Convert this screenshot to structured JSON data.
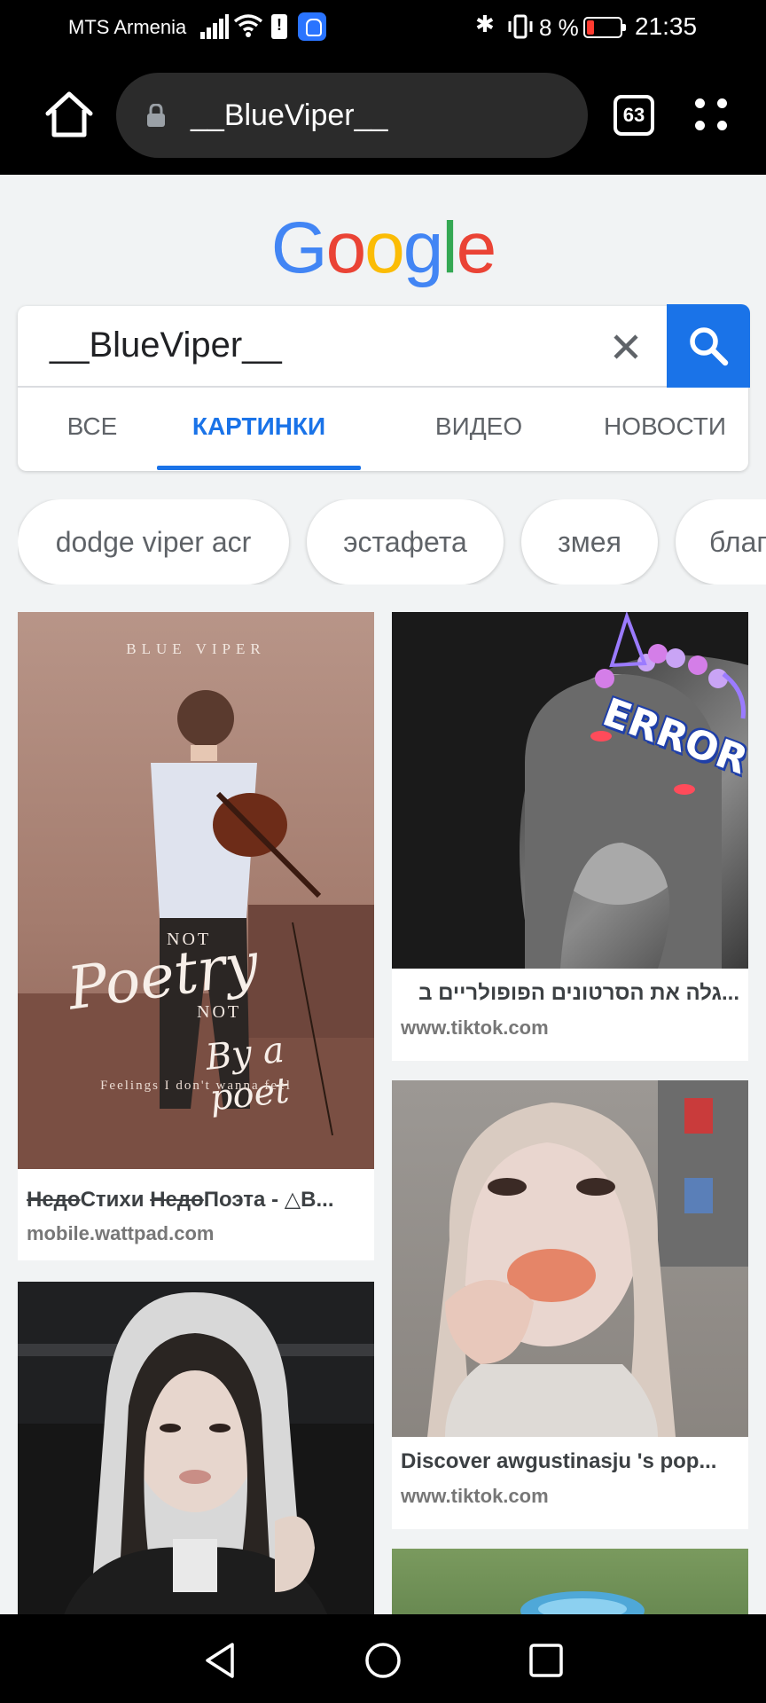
{
  "status_bar": {
    "carrier": "MTS Armenia",
    "battery_percent": "8 %",
    "time": "21:35",
    "battery_level": 0.08
  },
  "browser": {
    "url_text": "__BlueViper__",
    "tab_count": "63",
    "icons": [
      "home-icon",
      "lock-icon",
      "tabs-icon",
      "menu-icon"
    ]
  },
  "logo": {
    "letters": [
      "G",
      "o",
      "o",
      "g",
      "l",
      "e"
    ],
    "colors": [
      "#4285F4",
      "#EA4335",
      "#FBBC05",
      "#4285F4",
      "#34A853",
      "#EA4335"
    ]
  },
  "search": {
    "query": "__BlueViper__",
    "accent": "#1a73e8"
  },
  "tabs": [
    {
      "label": "ВСЕ",
      "active": false
    },
    {
      "label": "КАРТИНКИ",
      "active": true
    },
    {
      "label": "ВИДЕО",
      "active": false
    },
    {
      "label": "НОВОСТИ",
      "active": false
    }
  ],
  "chips": [
    "dodge viper acr",
    "эстафета",
    "змея",
    "благ"
  ],
  "results": [
    {
      "caption_strike_1": "Недо",
      "caption_1": "Стихи ",
      "caption_strike_2": "Недо",
      "caption_2": "Поэта - △B...",
      "source": "mobile.wattpad.com",
      "overlay_top": "BLUE VIPER",
      "overlay_script_1": "Poetry",
      "overlay_script_2": "By a poet",
      "overlay_not": "NOT",
      "overlay_bottom": "Feelings I don't wanna feel"
    },
    {
      "caption": "...גלה את הסרטונים הפופולריים ב",
      "source": "www.tiktok.com",
      "overlay": "ERROR"
    },
    {
      "caption": "Discover awgustinasju 's pop...",
      "source": "www.tiktok.com"
    },
    {
      "caption": "",
      "source": ""
    },
    {
      "caption": "",
      "source": ""
    }
  ],
  "nav_bar": {
    "icons": [
      "back-icon",
      "home-circle-icon",
      "recents-icon"
    ]
  }
}
